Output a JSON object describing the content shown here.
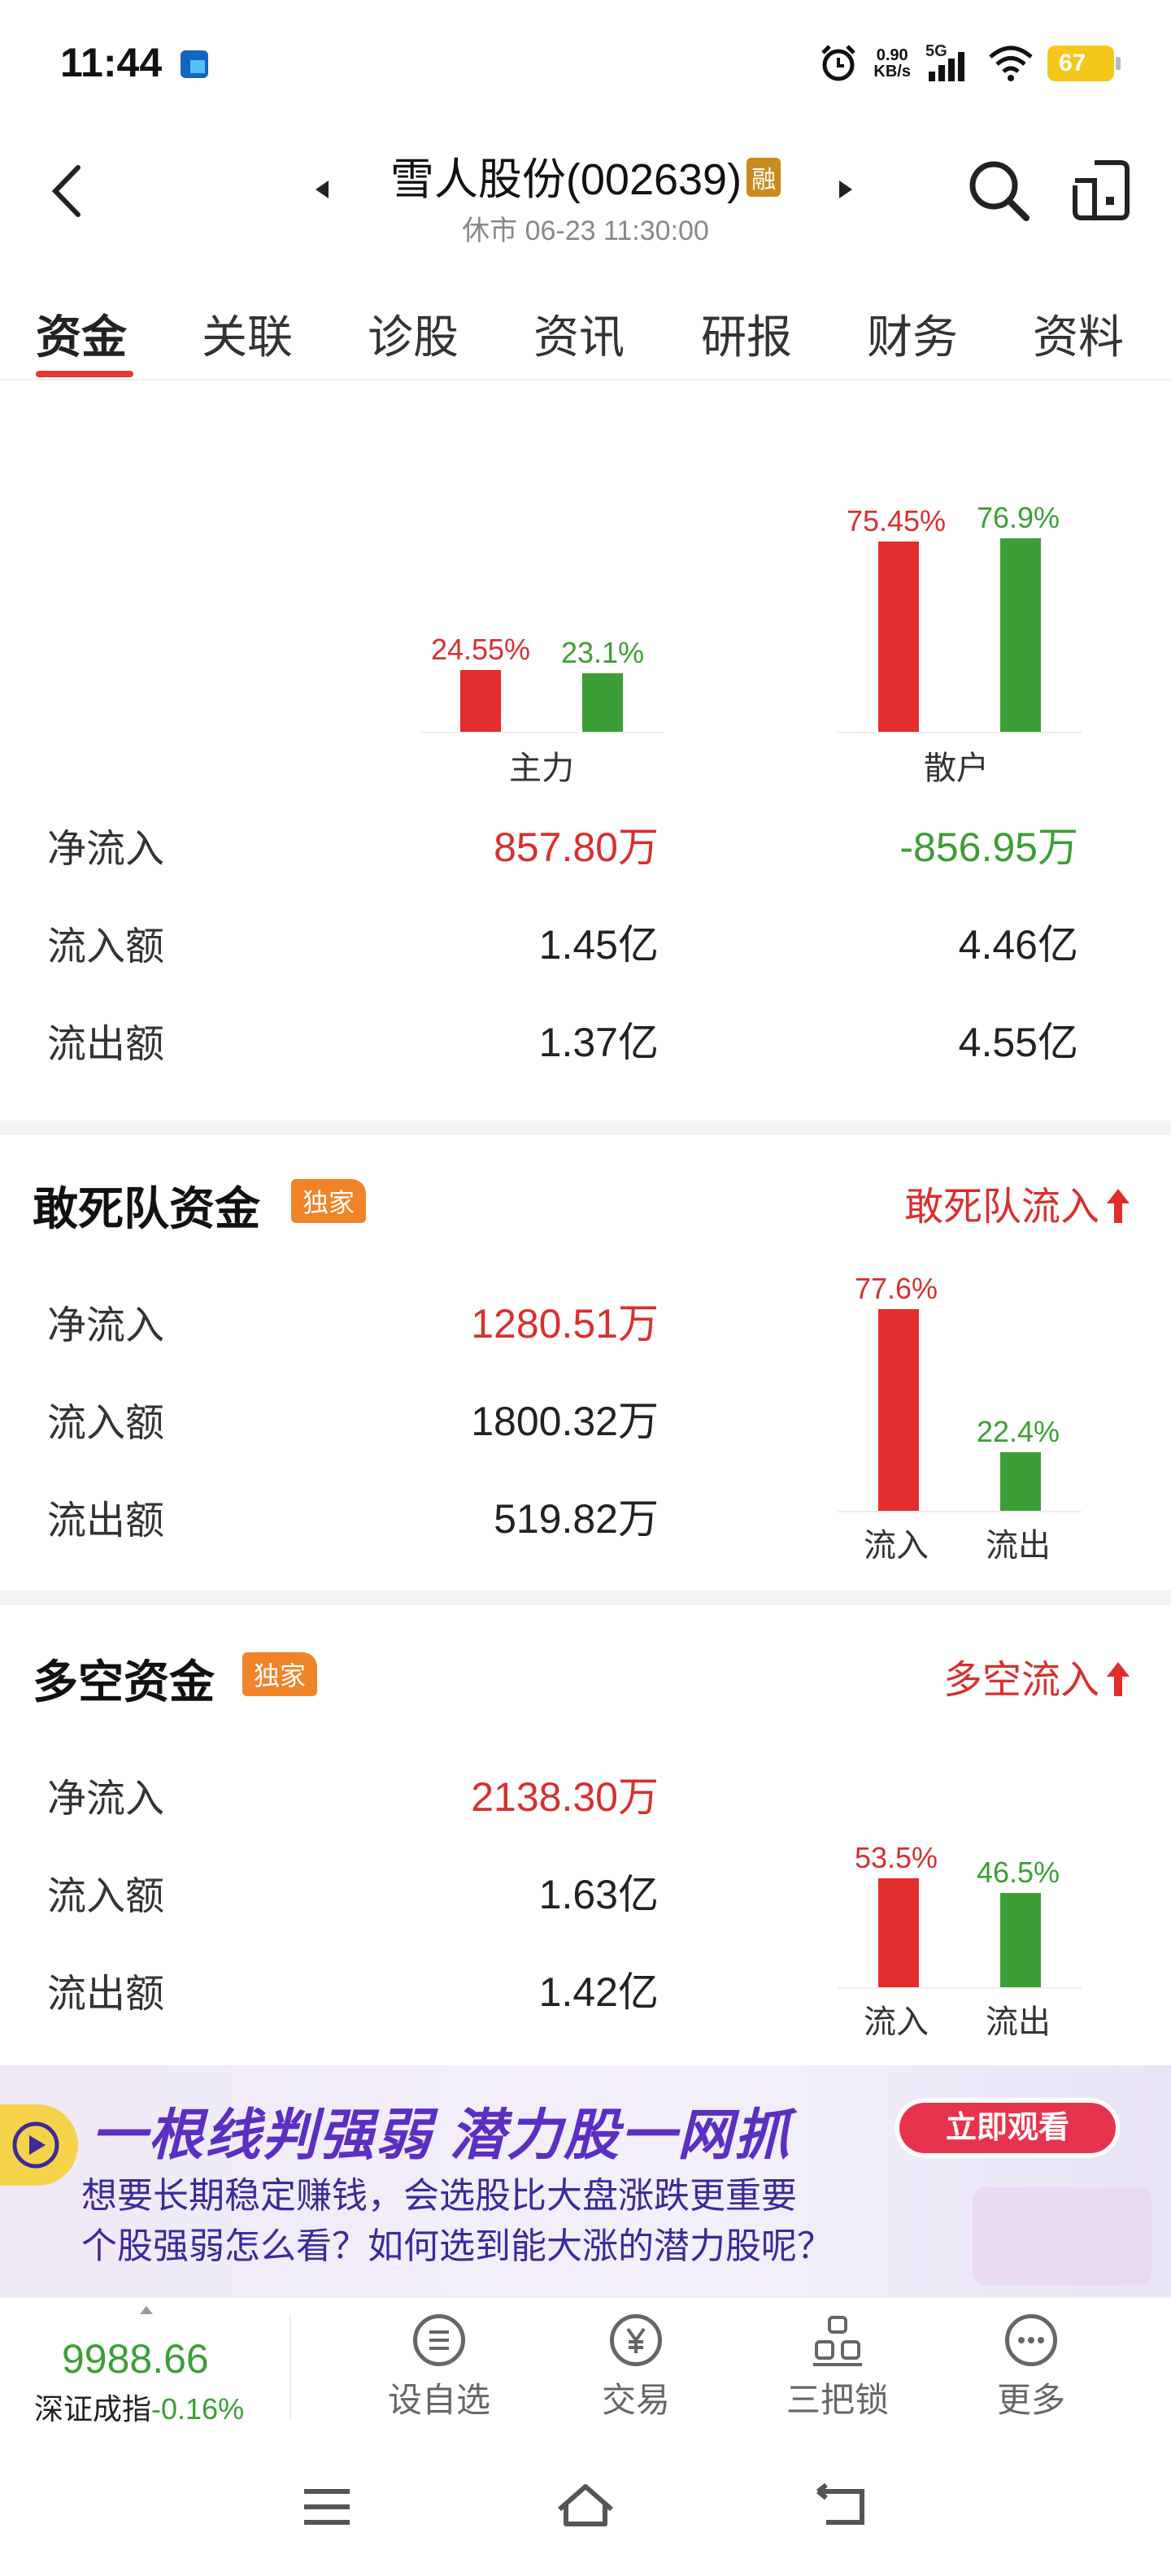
{
  "status": {
    "time": "11:44",
    "speed_value": "0.90",
    "speed_unit": "KB/s",
    "network": "5G",
    "battery": "67"
  },
  "header": {
    "title": "雪人股份(002639)",
    "badge": "融",
    "subtitle": "休市 06-23 11:30:00"
  },
  "tabs": [
    "资金",
    "关联",
    "诊股",
    "资讯",
    "研报",
    "财务",
    "资料"
  ],
  "active_tab": 0,
  "main_fund": {
    "groups": [
      {
        "name": "主力",
        "inflow_pct": 24.55,
        "outflow_pct": 23.1,
        "inflow_label": "24.55%",
        "outflow_label": "23.1%"
      },
      {
        "name": "散户",
        "inflow_pct": 75.45,
        "outflow_pct": 76.9,
        "inflow_label": "75.45%",
        "outflow_label": "76.9%"
      }
    ],
    "rows": [
      {
        "label": "净流入",
        "main": "857.80万",
        "retail": "-856.95万"
      },
      {
        "label": "流入额",
        "main": "1.45亿",
        "retail": "4.46亿"
      },
      {
        "label": "流出额",
        "main": "1.37亿",
        "retail": "4.55亿"
      }
    ]
  },
  "dare_fund": {
    "title": "敢死队资金",
    "tag": "独家",
    "link": "敢死队流入",
    "rows": [
      {
        "label": "净流入",
        "value": "1280.51万"
      },
      {
        "label": "流入额",
        "value": "1800.32万"
      },
      {
        "label": "流出额",
        "value": "519.82万"
      }
    ],
    "chart": {
      "inflow_pct": 77.6,
      "outflow_pct": 22.4,
      "inflow_label": "77.6%",
      "outflow_label": "22.4%",
      "in_cat": "流入",
      "out_cat": "流出"
    }
  },
  "longshort_fund": {
    "title": "多空资金",
    "tag": "独家",
    "link": "多空流入",
    "rows": [
      {
        "label": "净流入",
        "value": "2138.30万"
      },
      {
        "label": "流入额",
        "value": "1.63亿"
      },
      {
        "label": "流出额",
        "value": "1.42亿"
      }
    ],
    "chart": {
      "inflow_pct": 53.5,
      "outflow_pct": 46.5,
      "inflow_label": "53.5%",
      "outflow_label": "46.5%",
      "in_cat": "流入",
      "out_cat": "流出"
    }
  },
  "banner": {
    "headline": "一根线判强弱 潜力股一网抓",
    "cta": "立即观看",
    "line1": "想要长期稳定赚钱，会选股比大盘涨跌更重要",
    "line2": "个股强弱怎么看？如何选到能大涨的潜力股呢？"
  },
  "index": {
    "value": "9988.66",
    "name": "深证成指",
    "change": "-0.16%"
  },
  "bottom_nav": [
    {
      "label": "设自选",
      "icon": "list-icon"
    },
    {
      "label": "交易",
      "icon": "yen-icon"
    },
    {
      "label": "三把锁",
      "icon": "lock-group-icon"
    },
    {
      "label": "更多",
      "icon": "more-icon"
    }
  ],
  "colors": {
    "red": "#e32d2d",
    "green": "#3c9e36",
    "accent": "#e23b32",
    "tag": "#f08428"
  }
}
